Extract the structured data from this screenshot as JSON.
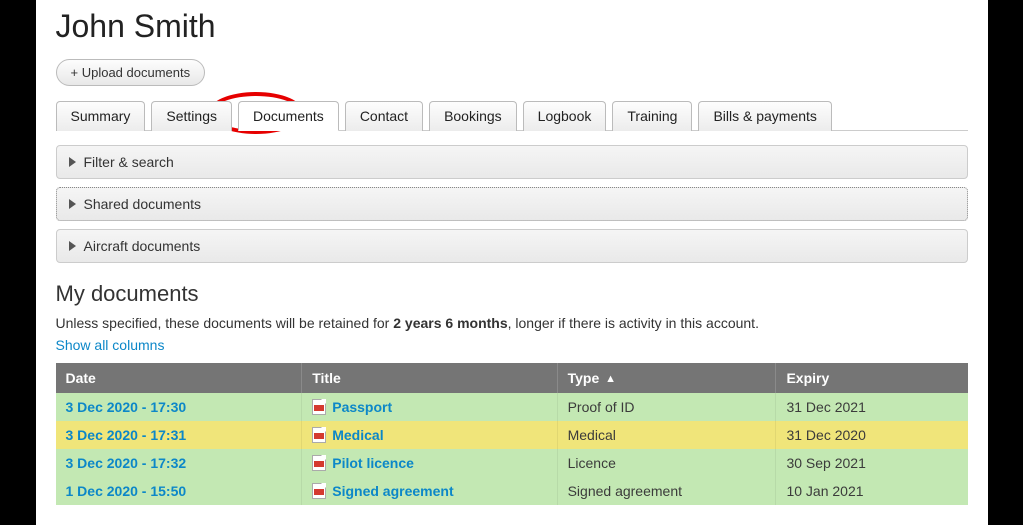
{
  "page_title": "John Smith",
  "upload_button": "+ Upload documents",
  "tabs": [
    {
      "label": "Summary",
      "active": false
    },
    {
      "label": "Settings",
      "active": false
    },
    {
      "label": "Documents",
      "active": true
    },
    {
      "label": "Contact",
      "active": false
    },
    {
      "label": "Bookings",
      "active": false
    },
    {
      "label": "Logbook",
      "active": false
    },
    {
      "label": "Training",
      "active": false
    },
    {
      "label": "Bills & payments",
      "active": false
    }
  ],
  "accordions": [
    {
      "label": "Filter & search",
      "style": "normal"
    },
    {
      "label": "Shared documents",
      "style": "dotted"
    },
    {
      "label": "Aircraft documents",
      "style": "normal"
    }
  ],
  "section_title": "My documents",
  "retention_prefix": "Unless specified, these documents will be retained for ",
  "retention_duration": "2 years 6 months",
  "retention_suffix": ", longer if there is activity in this account.",
  "show_all_link": "Show all columns",
  "table": {
    "headers": {
      "date": "Date",
      "title": "Title",
      "type": "Type",
      "expiry": "Expiry"
    },
    "sort_col": "type",
    "rows": [
      {
        "date": "3 Dec 2020 - 17:30",
        "title": "Passport",
        "type": "Proof of ID",
        "expiry": "31 Dec 2021",
        "row_class": "green"
      },
      {
        "date": "3 Dec 2020 - 17:31",
        "title": "Medical",
        "type": "Medical",
        "expiry": "31 Dec 2020",
        "row_class": "yellow"
      },
      {
        "date": "3 Dec 2020 - 17:32",
        "title": "Pilot licence",
        "type": "Licence",
        "expiry": "30 Sep 2021",
        "row_class": "green"
      },
      {
        "date": "1 Dec 2020 - 15:50",
        "title": "Signed agreement",
        "type": "Signed agreement",
        "expiry": "10 Jan 2021",
        "row_class": "green"
      }
    ]
  },
  "annotation": {
    "highlighted_tab": "Documents"
  }
}
